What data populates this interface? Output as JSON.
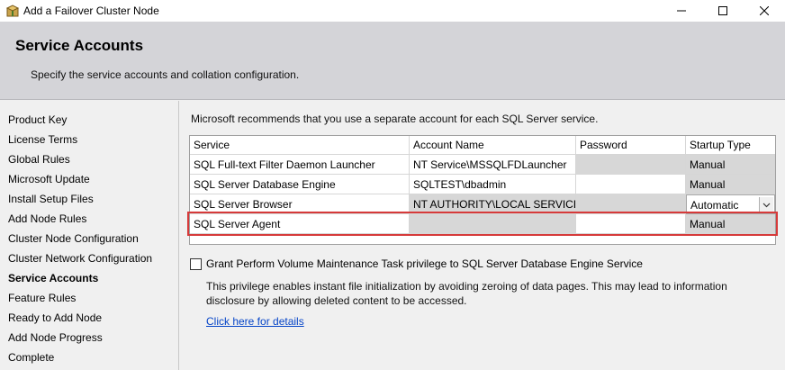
{
  "window": {
    "title": "Add a Failover Cluster Node"
  },
  "header": {
    "title": "Service Accounts",
    "subtitle": "Specify the service accounts and collation configuration."
  },
  "sidebar": {
    "items": [
      {
        "label": "Product Key",
        "active": false
      },
      {
        "label": "License Terms",
        "active": false
      },
      {
        "label": "Global Rules",
        "active": false
      },
      {
        "label": "Microsoft Update",
        "active": false
      },
      {
        "label": "Install Setup Files",
        "active": false
      },
      {
        "label": "Add Node Rules",
        "active": false
      },
      {
        "label": "Cluster Node Configuration",
        "active": false
      },
      {
        "label": "Cluster Network Configuration",
        "active": false
      },
      {
        "label": "Service Accounts",
        "active": true
      },
      {
        "label": "Feature Rules",
        "active": false
      },
      {
        "label": "Ready to Add Node",
        "active": false
      },
      {
        "label": "Add Node Progress",
        "active": false
      },
      {
        "label": "Complete",
        "active": false
      }
    ]
  },
  "main": {
    "intro": "Microsoft recommends that you use a separate account for each SQL Server service.",
    "table": {
      "headers": [
        "Service",
        "Account Name",
        "Password",
        "Startup Type"
      ],
      "rows": [
        {
          "service": "SQL Full-text Filter Daemon Launcher",
          "account": "NT Service\\MSSQLFDLauncher",
          "password": "",
          "startup": "Manual"
        },
        {
          "service": "SQL Server Database Engine",
          "account": "SQLTEST\\dbadmin",
          "password": "",
          "startup": "Manual"
        },
        {
          "service": "SQL Server Browser",
          "account": "NT AUTHORITY\\LOCAL SERVICE",
          "password": "",
          "startup": "Automatic"
        },
        {
          "service": "SQL Server Agent",
          "account": "",
          "password": "",
          "startup": "Manual"
        }
      ]
    },
    "grant_checkbox": {
      "label": "Grant Perform Volume Maintenance Task privilege to SQL Server Database Engine Service",
      "checked": false
    },
    "description": "This privilege enables instant file initialization by avoiding zeroing of data pages. This may lead to information disclosure by allowing deleted content to be accessed.",
    "details_link": "Click here for details"
  },
  "colors": {
    "header_bg": "#d4d4d8",
    "readonly_cell": "#d7d7d7",
    "highlight_border": "#d63a3a",
    "link": "#0645c8"
  }
}
